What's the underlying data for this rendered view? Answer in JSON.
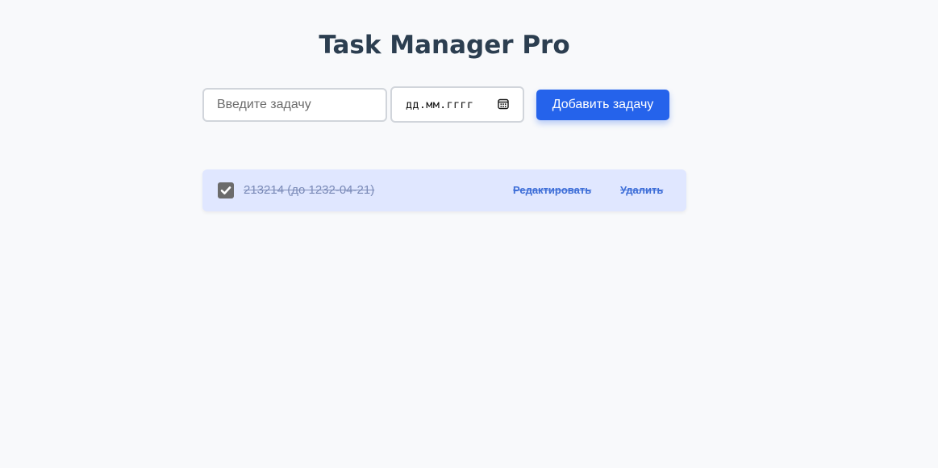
{
  "header": {
    "title": "Task Manager Pro"
  },
  "form": {
    "task_placeholder": "Введите задачу",
    "task_value": "",
    "date_placeholder": "дд.мм.гггг",
    "add_button_label": "Добавить задачу"
  },
  "tasks": [
    {
      "text": "213214 (до 1232-04-21)",
      "completed": true,
      "edit_label": "Редактировать",
      "delete_label": "Удалить"
    }
  ],
  "icons": {
    "date_picker": "calendar-icon",
    "checkbox": "checkmark-icon"
  },
  "colors": {
    "accent": "#2563eb",
    "task_background": "#e0e7ff",
    "title": "#2c3e50",
    "action_link": "#3f6fd8"
  }
}
